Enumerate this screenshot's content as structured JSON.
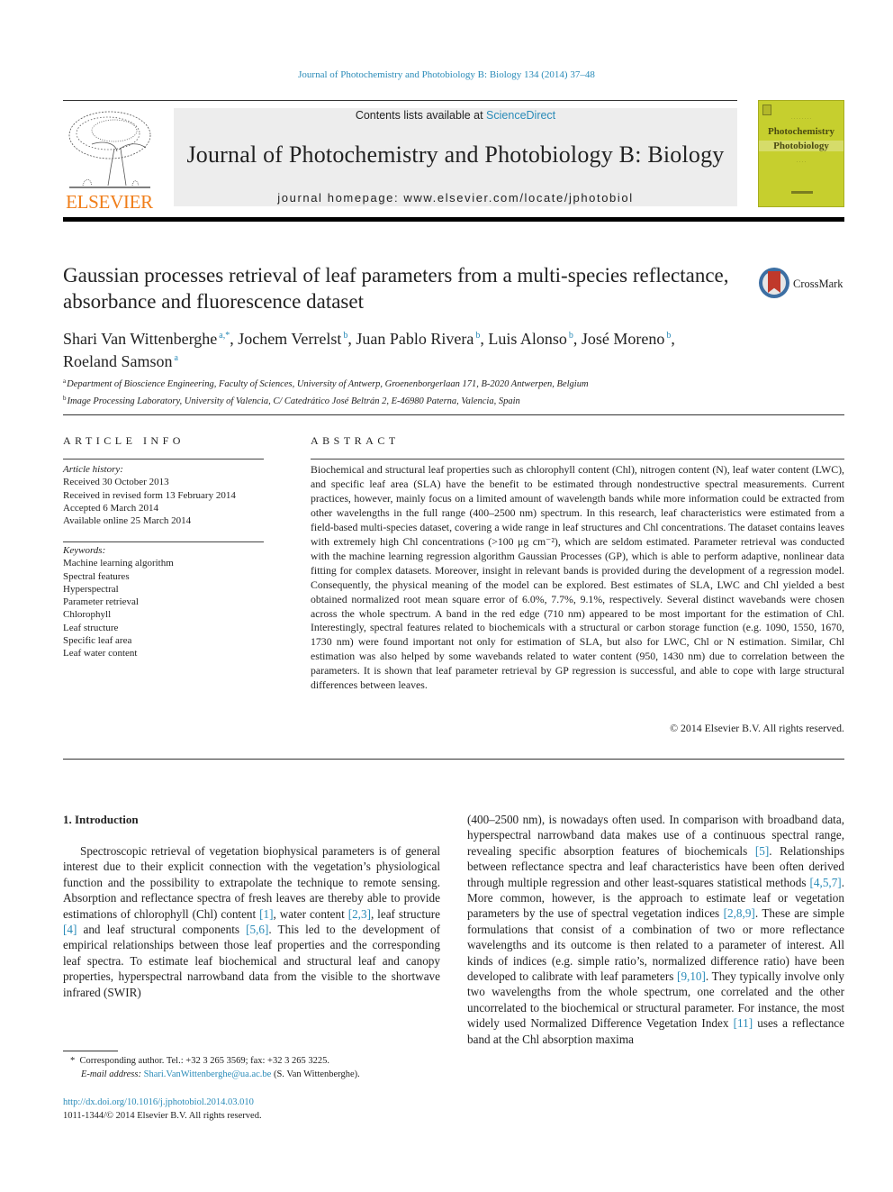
{
  "header": {
    "citation": "Journal of Photochemistry and Photobiology B: Biology 134 (2014) 37–48",
    "publisher_logo_text": "ELSEVIER",
    "contents_prefix": "Contents lists available at ",
    "contents_link": "ScienceDirect",
    "journal_name": "Journal of Photochemistry and Photobiology B: Biology",
    "homepage_prefix": "journal homepage: ",
    "homepage_url": "www.elsevier.com/locate/jphotobiol",
    "cover": {
      "line1": "Photochemistry",
      "line2": "Photobiology",
      "color": "#c6cf2e"
    },
    "brand_color": "#f07e1a",
    "link_color": "#2a8bb8"
  },
  "article": {
    "title": "Gaussian processes retrieval of leaf parameters from a multi-species reflectance, absorbance and fluorescence dataset",
    "crossmark_label": "CrossMark",
    "authors": [
      {
        "name": "Shari Van Wittenberghe",
        "sup": "a,*",
        "sep": ", "
      },
      {
        "name": "Jochem Verrelst",
        "sup": "b",
        "sep": ", "
      },
      {
        "name": "Juan Pablo Rivera",
        "sup": "b",
        "sep": ", "
      },
      {
        "name": "Luis Alonso",
        "sup": "b",
        "sep": ", "
      },
      {
        "name": "José Moreno",
        "sup": "b",
        "sep": ","
      },
      {
        "name": "Roeland Samson",
        "sup": "a",
        "sep": ""
      }
    ],
    "affiliations": [
      {
        "mark": "a",
        "text": "Department of Bioscience Engineering, Faculty of Sciences, University of Antwerp, Groenenborgerlaan 171, B-2020 Antwerpen, Belgium"
      },
      {
        "mark": "b",
        "text": "Image Processing Laboratory, University of Valencia, C/ Catedrático José Beltrán 2, E-46980 Paterna, Valencia, Spain"
      }
    ]
  },
  "article_info": {
    "heading": "ARTICLE INFO",
    "history_label": "Article history:",
    "history": [
      "Received 30 October 2013",
      "Received in revised form 13 February 2014",
      "Accepted 6 March 2014",
      "Available online 25 March 2014"
    ],
    "keywords_label": "Keywords:",
    "keywords": [
      "Machine learning algorithm",
      "Spectral features",
      "Hyperspectral",
      "Parameter retrieval",
      "Chlorophyll",
      "Leaf structure",
      "Specific leaf area",
      "Leaf water content"
    ]
  },
  "abstract": {
    "heading": "ABSTRACT",
    "text": "Biochemical and structural leaf properties such as chlorophyll content (Chl), nitrogen content (N), leaf water content (LWC), and specific leaf area (SLA) have the benefit to be estimated through nondestructive spectral measurements. Current practices, however, mainly focus on a limited amount of wavelength bands while more information could be extracted from other wavelengths in the full range (400–2500 nm) spectrum. In this research, leaf characteristics were estimated from a field-based multi-species dataset, covering a wide range in leaf structures and Chl concentrations. The dataset contains leaves with extremely high Chl concentrations (>100 μg cm⁻²), which are seldom estimated. Parameter retrieval was conducted with the machine learning regression algorithm Gaussian Processes (GP), which is able to perform adaptive, nonlinear data fitting for complex datasets. Moreover, insight in relevant bands is provided during the development of a regression model. Consequently, the physical meaning of the model can be explored. Best estimates of SLA, LWC and Chl yielded a best obtained normalized root mean square error of 6.0%, 7.7%, 9.1%, respectively. Several distinct wavebands were chosen across the whole spectrum. A band in the red edge (710 nm) appeared to be most important for the estimation of Chl. Interestingly, spectral features related to biochemicals with a structural or carbon storage function (e.g. 1090, 1550, 1670, 1730 nm) were found important not only for estimation of SLA, but also for LWC, Chl or N estimation. Similar, Chl estimation was also helped by some wavebands related to water content (950, 1430 nm) due to correlation between the parameters. It is shown that leaf parameter retrieval by GP regression is successful, and able to cope with large structural differences between leaves.",
    "copyright": "© 2014 Elsevier B.V. All rights reserved."
  },
  "body": {
    "section_heading": "1. Introduction",
    "left_column": [
      {
        "t": "Spectroscopic retrieval of vegetation biophysical parameters is of general interest due to their explicit connection with the vegetation’s physiological function and the possibility to extrapolate the technique to remote sensing. Absorption and reflectance spectra of fresh leaves are thereby able to provide estimations of chlorophyll (Chl) content "
      },
      {
        "ref": "[1]"
      },
      {
        "t": ", water content "
      },
      {
        "ref": "[2,3]"
      },
      {
        "t": ", leaf structure "
      },
      {
        "ref": "[4]"
      },
      {
        "t": " and leaf structural components "
      },
      {
        "ref": "[5,6]"
      },
      {
        "t": ". This led to the development of empirical relationships between those leaf properties and the corresponding leaf spectra. To estimate leaf biochemical and structural leaf and canopy properties, hyperspectral narrowband data from the visible to the shortwave infrared (SWIR)"
      }
    ],
    "right_column": [
      {
        "t": "(400–2500 nm), is nowadays often used. In comparison with broadband data, hyperspectral narrowband data makes use of a continuous spectral range, revealing specific absorption features of biochemicals "
      },
      {
        "ref": "[5]"
      },
      {
        "t": ". Relationships between reflectance spectra and leaf characteristics have been often derived through multiple regression and other least-squares statistical methods "
      },
      {
        "ref": "[4,5,7]"
      },
      {
        "t": ". More common, however, is the approach to estimate leaf or vegetation parameters by the use of spectral vegetation indices "
      },
      {
        "ref": "[2,8,9]"
      },
      {
        "t": ". These are simple formulations that consist of a combination of two or more reflectance wavelengths and its outcome is then related to a parameter of interest. All kinds of indices (e.g. simple ratio’s, normalized difference ratio) have been developed to calibrate with leaf parameters "
      },
      {
        "ref": "[9,10]"
      },
      {
        "t": ". They typically involve only two wavelengths from the whole spectrum, one correlated and the other uncorrelated to the biochemical or structural parameter. For instance, the most widely used Normalized Difference Vegetation Index "
      },
      {
        "ref": "[11]"
      },
      {
        "t": " uses a reflectance band at the Chl absorption maxima"
      }
    ]
  },
  "footnote": {
    "star": "*",
    "contact": "Corresponding author. Tel.: +32 3 265 3569; fax: +32 3 265 3225.",
    "email_label": "E-mail address: ",
    "email": "Shari.VanWittenberghe@ua.ac.be",
    "email_suffix": " (S. Van Wittenberghe).",
    "doi": "http://dx.doi.org/10.1016/j.jphotobiol.2014.03.010",
    "issn_line": "1011-1344/© 2014 Elsevier B.V. All rights reserved."
  }
}
